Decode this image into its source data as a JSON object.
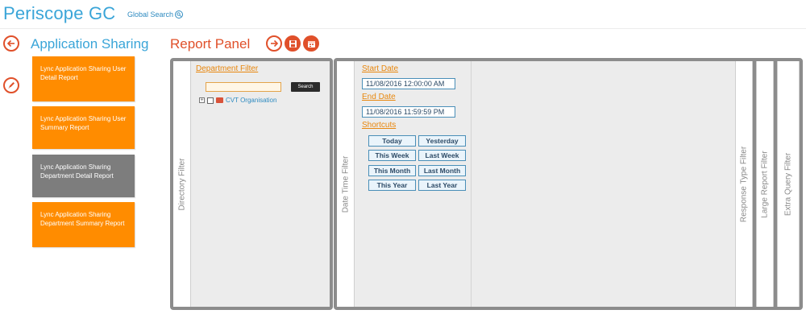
{
  "header": {
    "app_title": "Periscope GC",
    "global_search_label": "Global Search"
  },
  "nav": {
    "section_title": "Application Sharing",
    "panel_title": "Report Panel"
  },
  "reports": [
    {
      "label": "Lync Application Sharing User Detail Report",
      "active": false
    },
    {
      "label": "Lync Application Sharing User Summary Report",
      "active": false
    },
    {
      "label": "Lync Application Sharing Department Detail Report",
      "active": true
    },
    {
      "label": "Lync Application Sharing Department Summary Report",
      "active": false
    }
  ],
  "filters": {
    "directory_tab": "Directory Filter",
    "department_filter_label": "Department Filter",
    "department_input_value": "",
    "search_button": "Search",
    "tree_root": "CVT Organisation",
    "datetime_tab": "Date Time Filter",
    "start_date_label": "Start Date",
    "start_date_value": "11/08/2016 12:00:00 AM",
    "end_date_label": "End Date",
    "end_date_value": "11/08/2016 11:59:59 PM",
    "shortcuts_label": "Shortcuts",
    "shortcuts": [
      "Today",
      "Yesterday",
      "This Week",
      "Last Week",
      "This Month",
      "Last Month",
      "This Year",
      "Last Year"
    ],
    "response_type_tab": "Response Type Filter",
    "large_report_tab": "Large Report Filter",
    "extra_query_tab": "Extra Query Filter"
  },
  "colors": {
    "brand": "#3aa5d8",
    "accent": "#e0502a",
    "report_button": "#ff8c00",
    "report_button_active": "#7d7d7d"
  }
}
